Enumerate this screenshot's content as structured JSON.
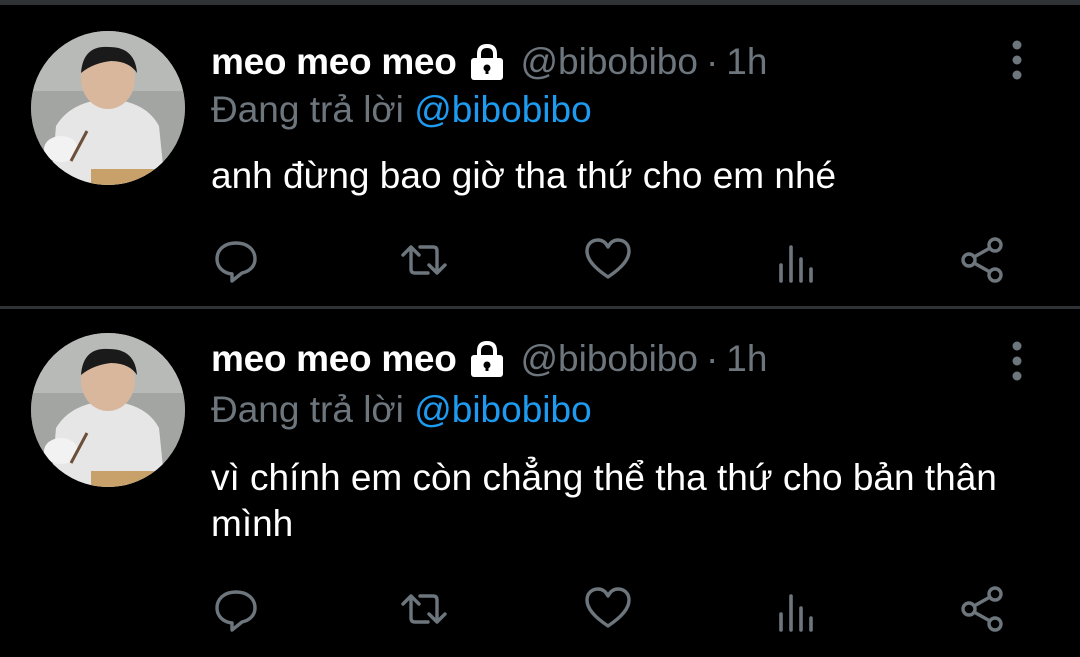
{
  "colors": {
    "background": "#000000",
    "divider": "#2f3336",
    "text_primary": "#ffffff",
    "text_secondary": "#6e767d",
    "link": "#1d9bf0"
  },
  "tweets": [
    {
      "display_name": "meo meo meo",
      "handle": "@bibobibo",
      "separator": "·",
      "time": "1h",
      "reply_prefix": "Đang trả lời",
      "reply_to": "@bibobibo",
      "text": "anh đừng bao giờ tha thứ cho em nhé",
      "icons": [
        "avatar",
        "lock-icon",
        "more-vertical-icon",
        "reply-icon",
        "retweet-icon",
        "like-icon",
        "stats-icon",
        "share-icon"
      ]
    },
    {
      "display_name": "meo meo meo",
      "handle": "@bibobibo",
      "separator": "·",
      "time": "1h",
      "reply_prefix": "Đang trả lời",
      "reply_to": "@bibobibo",
      "text": "vì chính em còn chẳng thể tha thứ cho bản thân mình",
      "icons": [
        "avatar",
        "lock-icon",
        "more-vertical-icon",
        "reply-icon",
        "retweet-icon",
        "like-icon",
        "stats-icon",
        "share-icon"
      ]
    }
  ]
}
